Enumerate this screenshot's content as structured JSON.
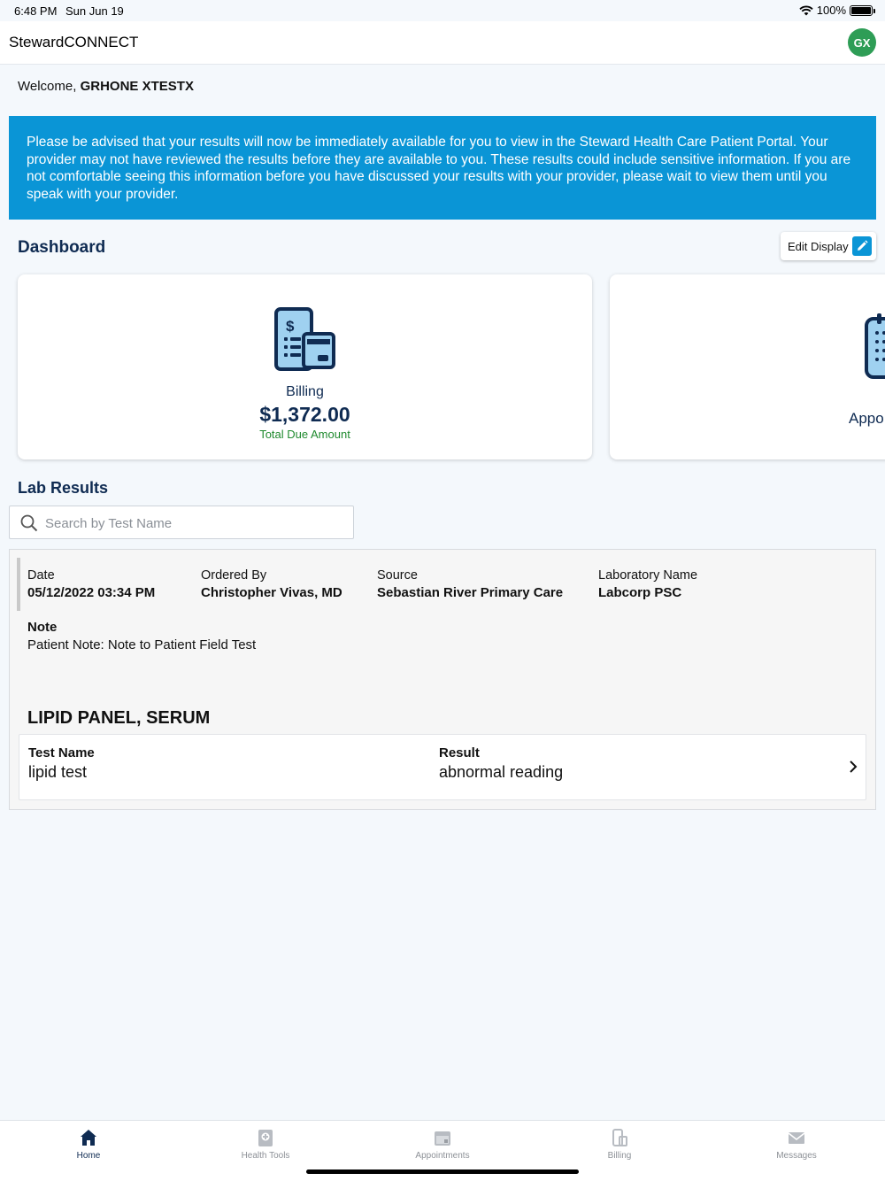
{
  "status_bar": {
    "time": "6:48 PM",
    "date": "Sun Jun 19",
    "battery": "100%"
  },
  "header": {
    "app_title": "StewardCONNECT",
    "avatar_initials": "GX"
  },
  "welcome": {
    "prefix": "Welcome,",
    "name": "GRHONE XTESTX"
  },
  "notice": {
    "text": "Please be advised that your results will now be immediately available for you to view in the Steward Health Care Patient Portal. Your provider may not have reviewed the results before they are available to you. These results could include sensitive information. If you are not comfortable seeing this information before you have discussed your results with your provider, please wait to view them until you speak with your provider."
  },
  "dashboard": {
    "title": "Dashboard",
    "edit_label": "Edit Display",
    "billing_card": {
      "label": "Billing",
      "amount": "$1,372.00",
      "sub": "Total Due Amount"
    },
    "appointments_card": {
      "label_partial": "Appo"
    }
  },
  "lab_results": {
    "title": "Lab Results",
    "search_placeholder": "Search by Test Name",
    "result": {
      "date_label": "Date",
      "date_value": "05/12/2022 03:34 PM",
      "ordered_label": "Ordered By",
      "ordered_value": "Christopher Vivas, MD",
      "source_label": "Source",
      "source_value": "Sebastian River Primary Care",
      "lab_label": "Laboratory Name",
      "lab_value": "Labcorp PSC",
      "note_label": "Note",
      "note_value": "Patient Note: Note to Patient Field Test",
      "panel_title": "LIPID PANEL, SERUM",
      "test_name_label": "Test Name",
      "test_name_value": "lipid test",
      "result_label": "Result",
      "result_value": "abnormal reading"
    }
  },
  "tabs": [
    {
      "label": "Home",
      "icon": "home-icon",
      "active": true
    },
    {
      "label": "Health Tools",
      "icon": "health-tools-icon",
      "active": false
    },
    {
      "label": "Appointments",
      "icon": "calendar-icon",
      "active": false
    },
    {
      "label": "Billing",
      "icon": "billing-icon",
      "active": false
    },
    {
      "label": "Messages",
      "icon": "envelope-icon",
      "active": false
    }
  ],
  "colors": {
    "brand_navy": "#0f2b52",
    "notice_blue": "#0a95d6",
    "avatar_green": "#2e9d56",
    "amount_sub_green": "#1f8a2e"
  }
}
